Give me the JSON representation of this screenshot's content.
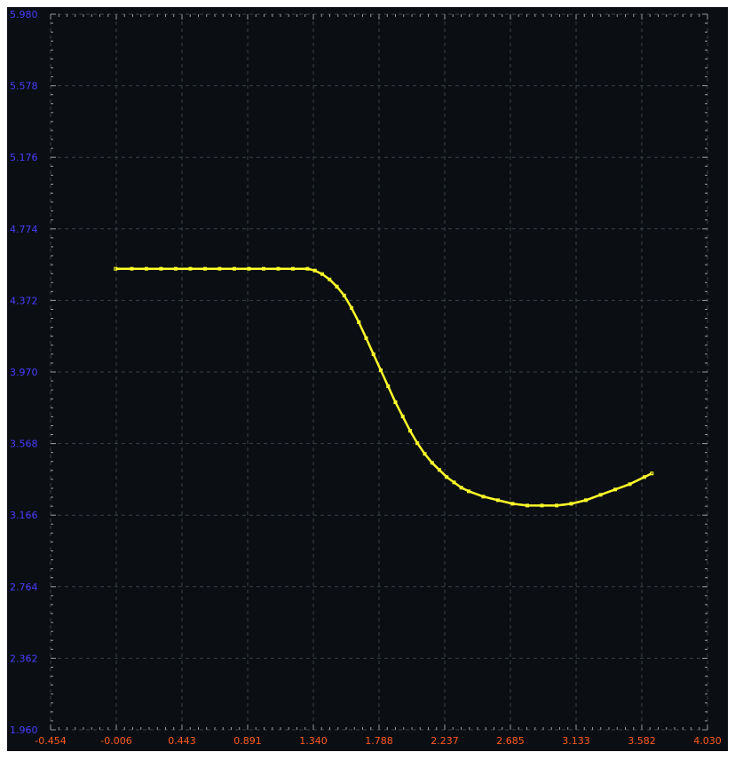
{
  "chart_data": {
    "type": "line",
    "title": "",
    "xlabel": "",
    "ylabel": "",
    "xlim": [
      -0.454,
      4.03
    ],
    "ylim": [
      1.96,
      5.98
    ],
    "x_ticks": [
      "-0.454",
      "-0.006",
      "0.443",
      "0.891",
      "1.340",
      "1.788",
      "2.237",
      "2.685",
      "3.133",
      "3.582",
      "4.030"
    ],
    "y_ticks": [
      "1.960",
      "2.362",
      "2.764",
      "3.166",
      "3.568",
      "3.970",
      "4.372",
      "4.774",
      "5.176",
      "5.578",
      "5.980"
    ],
    "grid": true,
    "legend": "none",
    "series": [
      {
        "x": [
          -0.01,
          0.1,
          0.2,
          0.3,
          0.4,
          0.5,
          0.6,
          0.7,
          0.8,
          0.9,
          1.0,
          1.1,
          1.2,
          1.3,
          1.35,
          1.4,
          1.45,
          1.5,
          1.55,
          1.6,
          1.65,
          1.7,
          1.75,
          1.8,
          1.85,
          1.9,
          1.95,
          2.0,
          2.05,
          2.1,
          2.15,
          2.2,
          2.25,
          2.3,
          2.35,
          2.4,
          2.5,
          2.6,
          2.7,
          2.8,
          2.9,
          3.0,
          3.1,
          3.2,
          3.3,
          3.4,
          3.5,
          3.6,
          3.65
        ],
        "y": [
          4.55,
          4.55,
          4.55,
          4.55,
          4.55,
          4.55,
          4.55,
          4.55,
          4.55,
          4.55,
          4.55,
          4.55,
          4.55,
          4.55,
          4.54,
          4.52,
          4.49,
          4.45,
          4.4,
          4.33,
          4.25,
          4.16,
          4.07,
          3.98,
          3.89,
          3.8,
          3.72,
          3.64,
          3.57,
          3.51,
          3.46,
          3.42,
          3.38,
          3.35,
          3.32,
          3.3,
          3.27,
          3.25,
          3.23,
          3.22,
          3.22,
          3.22,
          3.23,
          3.25,
          3.28,
          3.31,
          3.34,
          3.38,
          3.4
        ]
      }
    ]
  },
  "colors": {
    "plot_background": "#0b0f13",
    "grid": "#3b4146",
    "series": "#ffff2a",
    "x_tick_label": "#ff5a1f",
    "y_tick_label": "#4a3cff",
    "frame": "#c8c8c8"
  }
}
